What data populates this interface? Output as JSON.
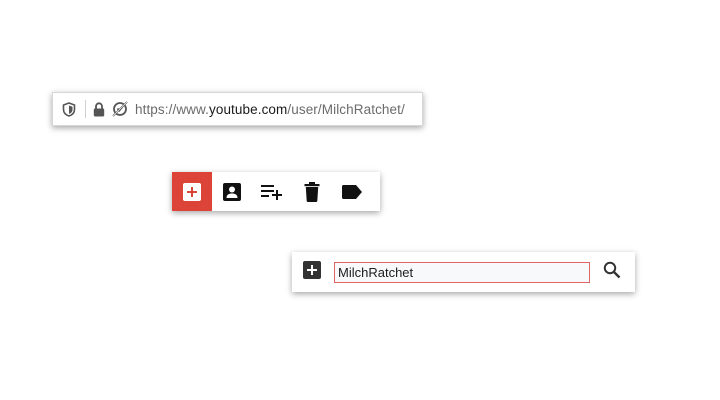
{
  "urlbar": {
    "url_prefix": "https://www.",
    "url_host": "youtube.com",
    "url_path": "/user/MilchRatchet/",
    "icons": [
      "shield-icon",
      "lock-icon",
      "permissions-blocked-icon"
    ]
  },
  "toolbar": {
    "accent_color": "#db4437",
    "buttons": [
      {
        "name": "add-button",
        "icon": "plus-box-icon",
        "active": true
      },
      {
        "name": "account-button",
        "icon": "account-box-icon",
        "active": false
      },
      {
        "name": "playlist-add-button",
        "icon": "playlist-add-icon",
        "active": false
      },
      {
        "name": "delete-button",
        "icon": "trash-icon",
        "active": false
      },
      {
        "name": "label-button",
        "icon": "label-icon",
        "active": false
      }
    ]
  },
  "search_panel": {
    "input_value": "MilchRatchet",
    "border_color": "#e06666",
    "icons": [
      "plus-box-icon",
      "search-icon"
    ]
  }
}
